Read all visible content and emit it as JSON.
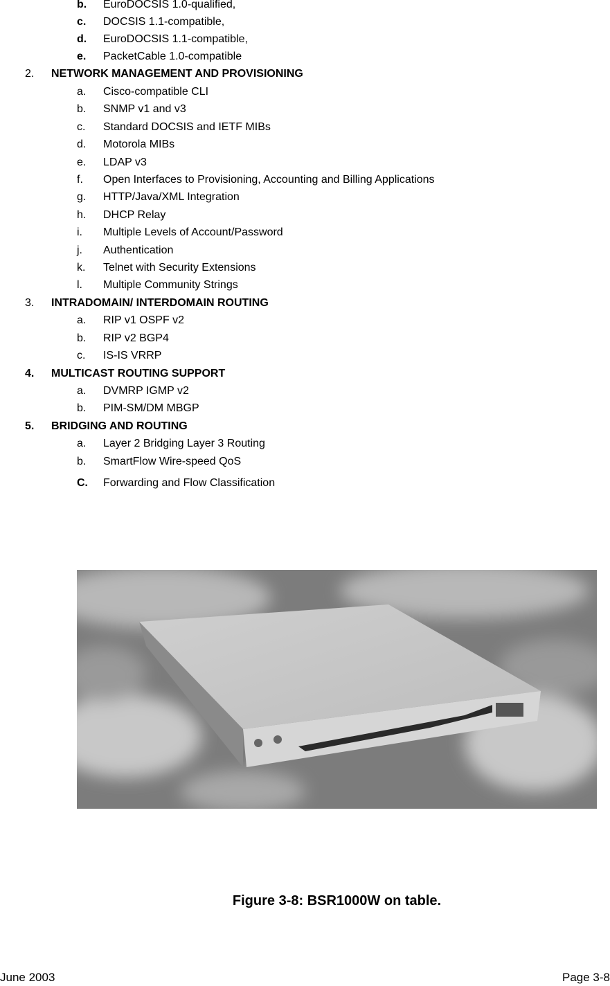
{
  "continued_items": [
    {
      "marker": "b.",
      "text": "EuroDOCSIS 1.0-qualified,"
    },
    {
      "marker": "c.",
      "text": "DOCSIS 1.1-compatible,"
    },
    {
      "marker": "d.",
      "text": "EuroDOCSIS 1.1-compatible,"
    },
    {
      "marker": "e.",
      "text": "PacketCable 1.0-compatible"
    }
  ],
  "sections": [
    {
      "number": "2.",
      "title": "NETWORK MANAGEMENT AND PROVISIONING",
      "items": [
        {
          "marker": "a.",
          "text": "Cisco-compatible CLI"
        },
        {
          "marker": "b.",
          "text": "SNMP v1 and v3"
        },
        {
          "marker": "c.",
          "text": "Standard DOCSIS and IETF MIBs"
        },
        {
          "marker": "d.",
          "text": "Motorola MIBs"
        },
        {
          "marker": "e.",
          "text": "LDAP v3"
        },
        {
          "marker": "f.",
          "text": "Open Interfaces to Provisioning, Accounting and Billing Applications"
        },
        {
          "marker": "g.",
          "text": "HTTP/Java/XML Integration"
        },
        {
          "marker": "h.",
          "text": "DHCP Relay"
        },
        {
          "marker": "i.",
          "text": "Multiple Levels of Account/Password"
        },
        {
          "marker": "j.",
          "text": "Authentication"
        },
        {
          "marker": "k.",
          "text": "Telnet with Security Extensions"
        },
        {
          "marker": "l.",
          "text": "Multiple Community Strings"
        }
      ]
    },
    {
      "number": "3.",
      "title": "INTRADOMAIN/ INTERDOMAIN ROUTING",
      "items": [
        {
          "marker": "a.",
          "text": "RIP v1 OSPF v2"
        },
        {
          "marker": "b.",
          "text": "RIP v2 BGP4"
        },
        {
          "marker": "c.",
          "text": "IS-IS VRRP"
        }
      ]
    },
    {
      "number": "4.",
      "title": "MULTICAST ROUTING SUPPORT",
      "items": [
        {
          "marker": "a.",
          "text": "DVMRP IGMP v2"
        },
        {
          "marker": "b.",
          "text": "PIM-SM/DM MBGP"
        }
      ]
    },
    {
      "number": "5.",
      "title": "BRIDGING AND ROUTING",
      "items": [
        {
          "marker": "a.",
          "text": "Layer 2 Bridging Layer 3 Routing"
        },
        {
          "marker": "b.",
          "text": "SmartFlow Wire-speed QoS"
        },
        {
          "marker": "C.",
          "text": "Forwarding and Flow Classification"
        }
      ]
    }
  ],
  "figure": {
    "image_alt": "BSR1000W device photo",
    "caption": "Figure 3-8: BSR1000W on table."
  },
  "footer": {
    "date": "June 2003",
    "page": "Page 3-8"
  }
}
